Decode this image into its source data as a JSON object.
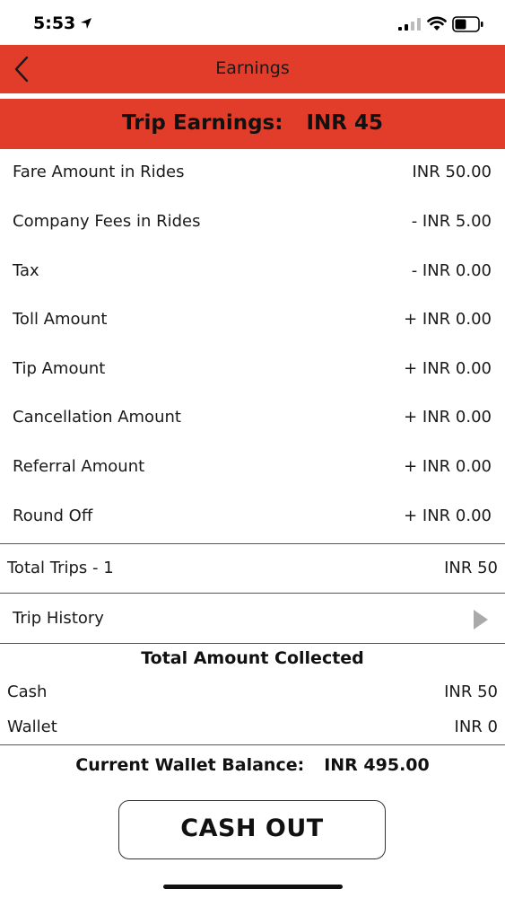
{
  "status_bar": {
    "time": "5:53"
  },
  "header": {
    "title": "Earnings"
  },
  "banner": {
    "label": "Trip Earnings:",
    "value": "INR 45"
  },
  "breakdown": [
    {
      "label": "Fare Amount in Rides",
      "value": "INR 50.00"
    },
    {
      "label": "Company Fees in Rides",
      "value": "- INR 5.00"
    },
    {
      "label": "Tax",
      "value": "- INR 0.00"
    },
    {
      "label": "Toll Amount",
      "value": "+ INR 0.00"
    },
    {
      "label": "Tip Amount",
      "value": "+ INR 0.00"
    },
    {
      "label": "Cancellation Amount",
      "value": "+ INR 0.00"
    },
    {
      "label": "Referral Amount",
      "value": "+ INR 0.00"
    },
    {
      "label": "Round Off",
      "value": "+ INR 0.00"
    }
  ],
  "total_trips": {
    "label": "Total Trips - 1",
    "value": "INR 50"
  },
  "trip_history": {
    "label": "Trip History"
  },
  "collected": {
    "title": "Total Amount Collected",
    "cash_label": "Cash",
    "cash_value": "INR 50",
    "wallet_label": "Wallet",
    "wallet_value": "INR 0"
  },
  "wallet_balance": {
    "label": "Current Wallet Balance:",
    "value": "INR 495.00"
  },
  "cashout": {
    "label": "CASH OUT"
  },
  "colors": {
    "accent": "#e23c2a",
    "arrow": "#aaaaaa"
  },
  "icons": [
    "location-arrow-icon",
    "signal-icon",
    "wifi-icon",
    "battery-icon",
    "back-chevron-icon",
    "play-arrow-icon"
  ]
}
